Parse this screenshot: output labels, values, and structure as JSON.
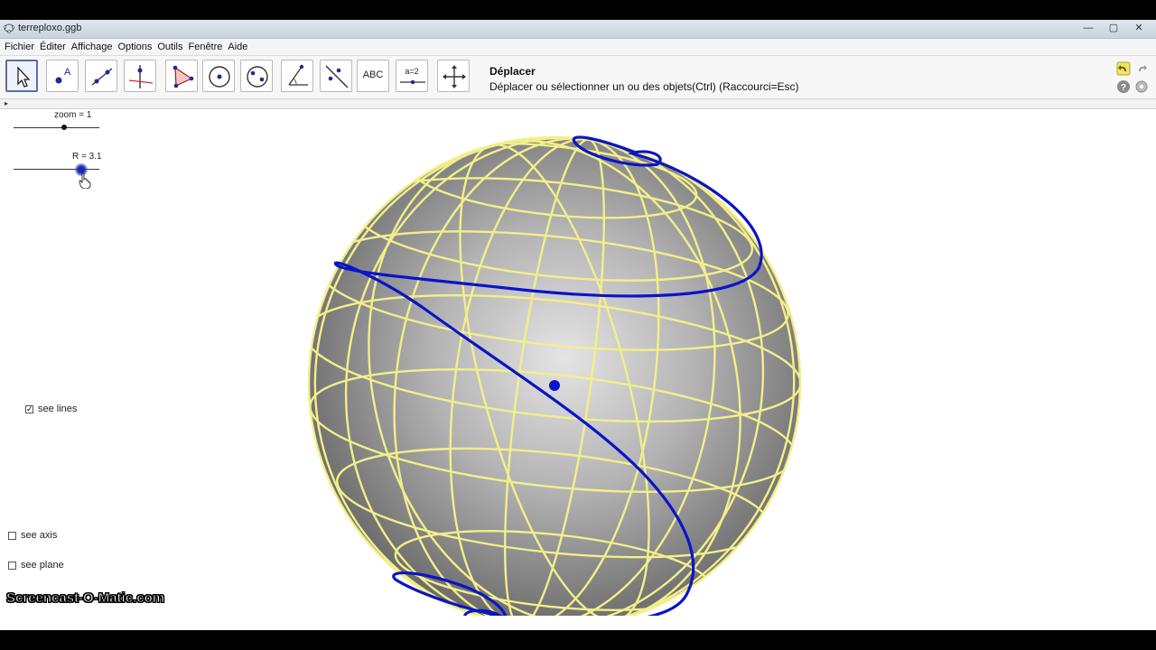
{
  "window": {
    "title": "terreploxo.ggb",
    "buttons": [
      "—",
      "▢",
      "✕"
    ]
  },
  "menu": [
    "Fichier",
    "Éditer",
    "Affichage",
    "Options",
    "Outils",
    "Fenêtre",
    "Aide"
  ],
  "toolbar": {
    "tools": [
      {
        "name": "move-tool",
        "icon": "arrow-pointer-icon"
      },
      {
        "name": "point-tool",
        "icon": "point-icon"
      },
      {
        "name": "line-tool",
        "icon": "line-icon"
      },
      {
        "name": "perpendicular-tool",
        "icon": "perpendicular-icon"
      },
      {
        "name": "polygon-tool",
        "icon": "triangle-icon"
      },
      {
        "name": "circle-tool",
        "icon": "circle-center-icon"
      },
      {
        "name": "circle-3points-tool",
        "icon": "circle-points-icon"
      },
      {
        "name": "angle-tool",
        "icon": "angle-icon"
      },
      {
        "name": "reflect-tool",
        "icon": "reflect-icon"
      },
      {
        "name": "text-tool",
        "icon": "text-icon",
        "label": "ABC"
      },
      {
        "name": "slider-tool",
        "icon": "slider-icon",
        "label": "a=2"
      },
      {
        "name": "move-graphics-tool",
        "icon": "move-cross-icon"
      }
    ],
    "active_tool_name": "Déplacer",
    "active_tool_help": "Déplacer ou sélectionner un ou des objets(Ctrl) (Raccourci=Esc)"
  },
  "canvas": {
    "sliders": [
      {
        "label": "zoom = 1",
        "value": 1
      },
      {
        "label": "R = 3.1",
        "value": 3.1
      }
    ],
    "checkboxes": [
      {
        "label": "see lines",
        "checked": true
      },
      {
        "label": "see axis",
        "checked": false
      },
      {
        "label": "see plane",
        "checked": false
      }
    ],
    "colors": {
      "sphere": "#9a9a9a",
      "grid_lines": "#f2ef8a",
      "loxodrome": "#0a14c8"
    }
  },
  "watermark": "Screencast-O-Matic.com"
}
